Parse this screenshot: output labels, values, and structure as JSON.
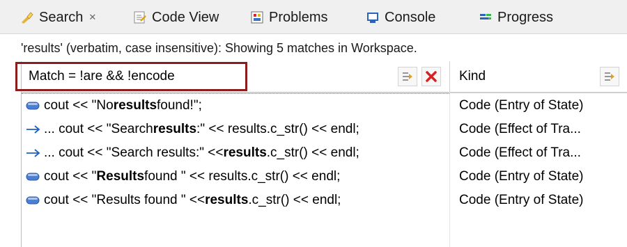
{
  "tabs": [
    {
      "label": "Search",
      "icon": "search-flashlight-icon",
      "active": true,
      "close": "✕"
    },
    {
      "label": "Code View",
      "icon": "code-view-icon"
    },
    {
      "label": "Problems",
      "icon": "problems-icon"
    },
    {
      "label": "Console",
      "icon": "console-icon"
    },
    {
      "label": "Progress",
      "icon": "progress-icon"
    }
  ],
  "status": "'results' (verbatim, case insensitive): Showing 5 matches in Workspace.",
  "columns": {
    "match": "Match = !are && !encode",
    "kind": "Kind"
  },
  "rows": [
    {
      "icon": "state-entry-icon",
      "pre": "cout << \"No ",
      "bold": "results",
      "post": " found!\";",
      "kind": "Code (Entry of State)"
    },
    {
      "icon": "transition-arrow-icon",
      "pre": "... cout << \"Search ",
      "bold": "results",
      "post": ":\" << results.c_str() << endl;",
      "kind": "Code (Effect of Tra..."
    },
    {
      "icon": "transition-arrow-icon",
      "pre": "... cout << \"Search results:\" << ",
      "bold": "results",
      "post": ".c_str() << endl;",
      "kind": "Code (Effect of Tra..."
    },
    {
      "icon": "state-entry-icon",
      "pre": "cout << \"",
      "bold": "Results",
      "post": " found \" << results.c_str() << endl;",
      "kind": "Code (Entry of State)"
    },
    {
      "icon": "state-entry-icon",
      "pre": "cout << \"Results found \" << ",
      "bold": "results",
      "post": ".c_str() << endl;",
      "kind": "Code (Entry of State)"
    }
  ],
  "colors": {
    "highlight": "#8b1d1d",
    "state_icon": "#4a7fd4",
    "arrow": "#1f5fbf",
    "remove_red": "#d92020"
  }
}
